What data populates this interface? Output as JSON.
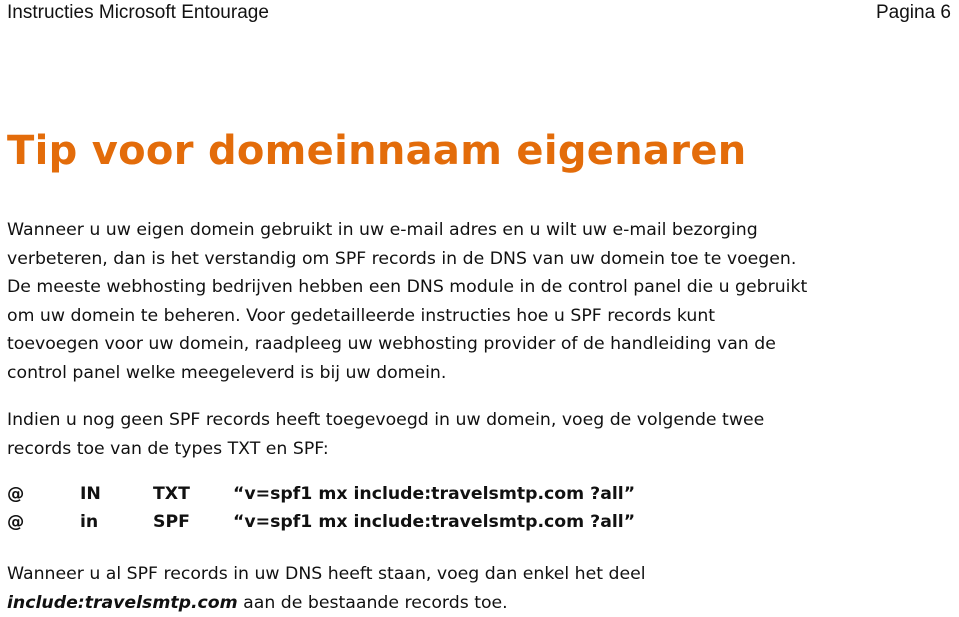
{
  "header": {
    "document_title": "Instructies Microsoft Entourage",
    "page_label": "Pagina 6"
  },
  "title": {
    "text": "Tip voor domeinnaam eigenaren",
    "color": "#E36C0A"
  },
  "paragraph1": {
    "lines": [
      "Wanneer u uw eigen domein gebruikt in uw e-mail adres en u wilt uw e-mail bezorging",
      "verbeteren, dan is het verstandig om SPF records in de DNS van uw domein toe te voegen.",
      "De meeste webhosting bedrijven hebben een DNS module in de control panel die u gebruikt",
      "om uw domein te beheren. Voor gedetailleerde instructies hoe u SPF records kunt",
      "toevoegen voor uw domein, raadpleeg uw webhosting provider of de handleiding van de",
      "control panel welke meegeleverd is bij uw domein."
    ]
  },
  "paragraph2": {
    "lines": [
      "Indien u nog geen SPF records heeft toegevoegd in uw domein, voeg de volgende twee",
      "records toe van de types TXT en SPF:"
    ]
  },
  "records": [
    {
      "host": "@",
      "class": "IN",
      "type": "TXT",
      "value": "“v=spf1 mx include:travelsmtp.com ?all”"
    },
    {
      "host": "@",
      "class": "in",
      "type": "SPF",
      "value": "“v=spf1 mx include:travelsmtp.com ?all”"
    }
  ],
  "paragraph3": {
    "line1": "Wanneer u al SPF records in uw DNS heeft staan, voeg dan enkel het deel",
    "emphasis": "include:travelsmtp.com",
    "line2_rest": " aan de bestaande records toe."
  }
}
